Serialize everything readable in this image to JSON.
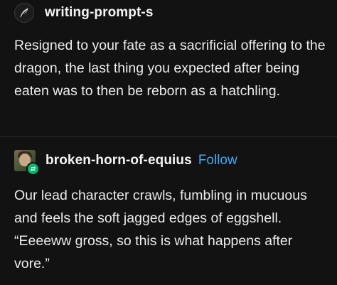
{
  "posts": [
    {
      "username": "writing-prompt-s",
      "avatar_icon": "quill-pen-icon",
      "body": "Resigned to your fate as a sacrificial offering to the dragon, the last thing you expected after being eaten was to then be reborn as a hatchling."
    },
    {
      "username": "broken-horn-of-equius",
      "follow_label": "Follow",
      "badge_icon": "reblog-icon",
      "body": "Our lead character crawls, fumbling in mucuous and feels the soft jagged edges of eggshell. “Eeeeww gross, so this is what happens after vore.”"
    }
  ],
  "colors": {
    "background": "#121212",
    "text": "#ececec",
    "follow": "#3fa9f5",
    "reblog_badge": "#00b86b"
  }
}
